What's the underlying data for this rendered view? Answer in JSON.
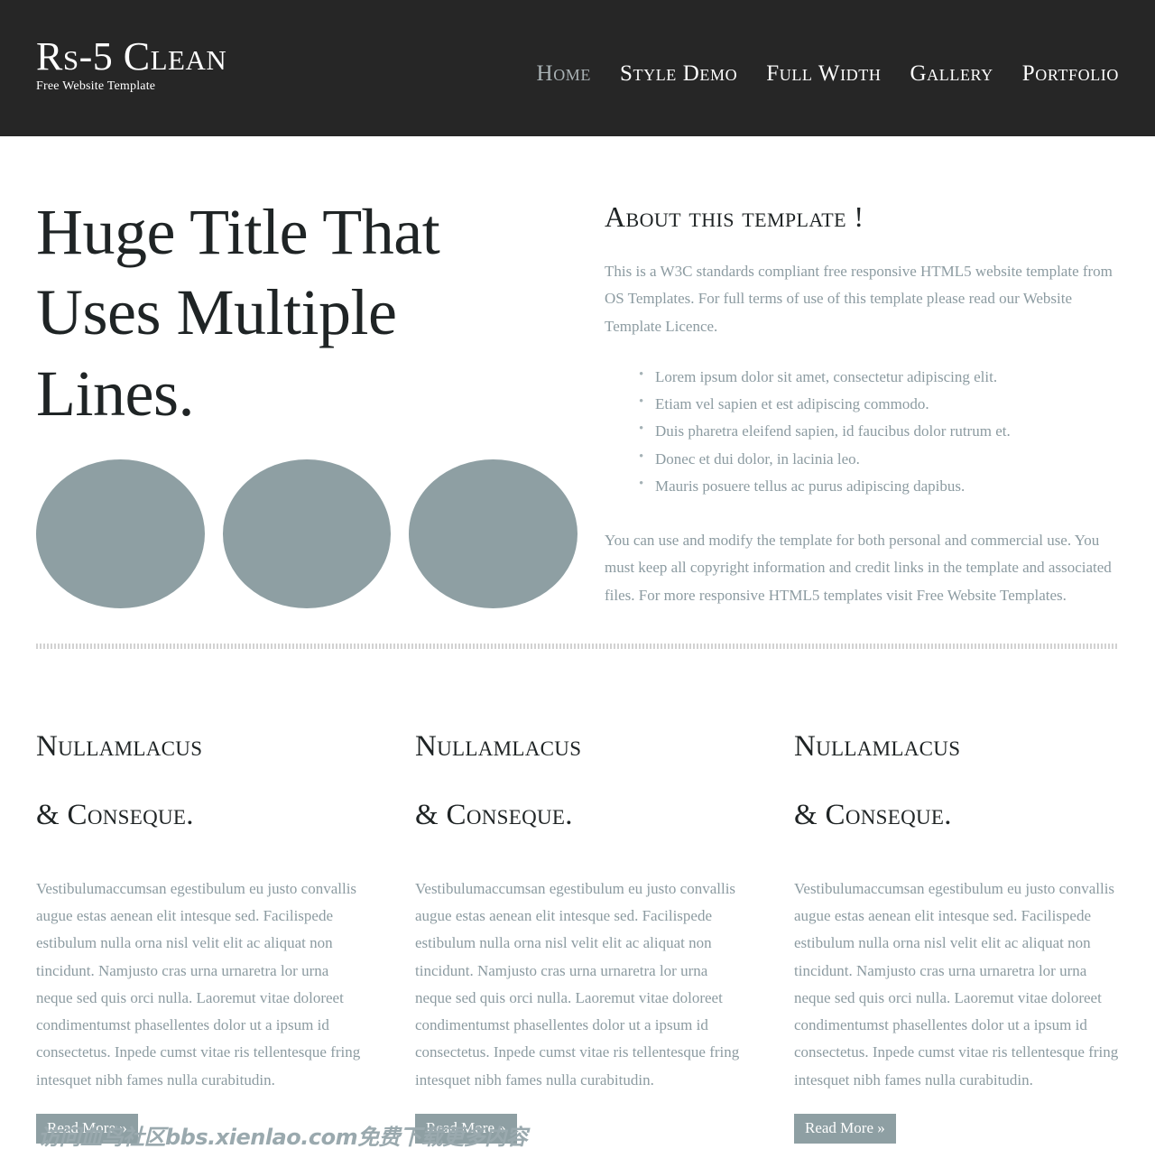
{
  "header": {
    "brand_title": "Rs-5 Clean",
    "brand_tagline": "Free Website Template",
    "background_color": "#262626",
    "nav": [
      {
        "label": "Home",
        "active": true
      },
      {
        "label": "Style Demo",
        "active": false
      },
      {
        "label": "Full Width",
        "active": false
      },
      {
        "label": "Gallery",
        "active": false
      },
      {
        "label": "Portfolio",
        "active": false
      }
    ]
  },
  "intro": {
    "huge_title": "Huge Title That Uses Multiple Lines.",
    "circle_color": "#8e9fa3",
    "circles": [
      "circle-1",
      "circle-2",
      "circle-3"
    ],
    "about": {
      "heading": "About this template !",
      "paragraph_1": "This is a W3C standards compliant free responsive HTML5 website template from OS Templates. For full terms of use of this template please read our Website Template Licence.",
      "list": [
        "Lorem ipsum dolor sit amet, consectetur adipiscing elit.",
        "Etiam vel sapien et est adipiscing commodo.",
        "Duis pharetra eleifend sapien, id faucibus dolor rutrum et.",
        "Donec et dui dolor, in lacinia leo.",
        "Mauris posuere tellus ac purus adipiscing dapibus."
      ],
      "paragraph_2": "You can use and modify the template for both personal and commercial use. You must keep all copyright information and credit links in the template and associated files. For more responsive HTML5 templates visit Free Website Templates."
    }
  },
  "columns": [
    {
      "heading_line_1": "Nullamlacus",
      "heading_line_2": "& Conseque.",
      "body": "Vestibulumaccumsan egestibulum eu justo convallis augue estas aenean elit intesque sed. Facilispede estibulum nulla orna nisl velit elit ac aliquat non tincidunt. Namjusto cras urna urnaretra lor urna neque sed quis orci nulla. Laoremut vitae doloreet condimentumst phasellentes dolor ut a ipsum id consectetus. Inpede cumst vitae ris tellentesque fring intesquet nibh fames nulla curabitudin.",
      "read_more": "Read More »"
    },
    {
      "heading_line_1": "Nullamlacus",
      "heading_line_2": "& Conseque.",
      "body": "Vestibulumaccumsan egestibulum eu justo convallis augue estas aenean elit intesque sed. Facilispede estibulum nulla orna nisl velit elit ac aliquat non tincidunt. Namjusto cras urna urnaretra lor urna neque sed quis orci nulla. Laoremut vitae doloreet condimentumst phasellentes dolor ut a ipsum id consectetus. Inpede cumst vitae ris tellentesque fring intesquet nibh fames nulla curabitudin.",
      "read_more": "Read More »"
    },
    {
      "heading_line_1": "Nullamlacus",
      "heading_line_2": "& Conseque.",
      "body": "Vestibulumaccumsan egestibulum eu justo convallis augue estas aenean elit intesque sed. Facilispede estibulum nulla orna nisl velit elit ac aliquat non tincidunt. Namjusto cras urna urnaretra lor urna neque sed quis orci nulla. Laoremut vitae doloreet condimentumst phasellentes dolor ut a ipsum id consectetus. Inpede cumst vitae ris tellentesque fring intesquet nibh fames nulla curabitudin.",
      "read_more": "Read More »"
    }
  ],
  "watermark": {
    "text": "访问血鸟社区bbs.xienlao.com免费下载更多内容",
    "color": "#9aa9ae"
  }
}
